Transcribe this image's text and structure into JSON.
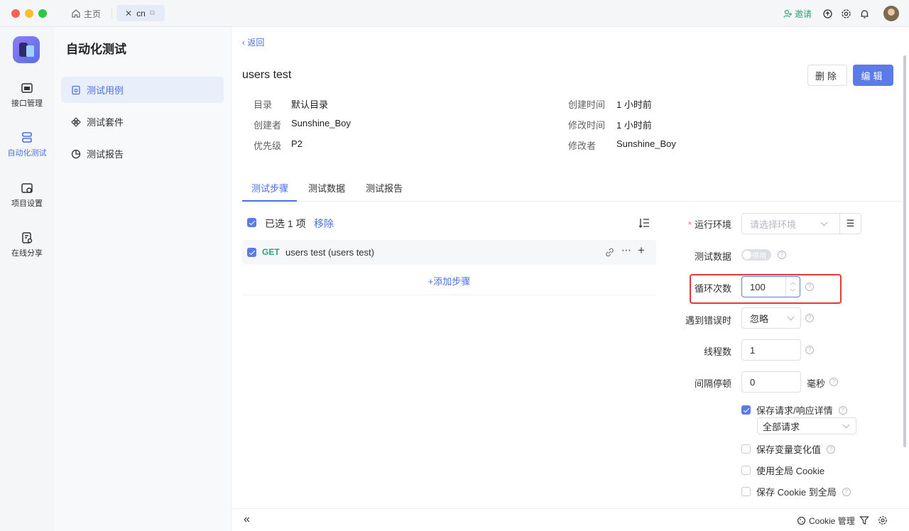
{
  "titlebar": {
    "home_tab": "主页",
    "active_tab": "cn",
    "invite": "邀请"
  },
  "rail": {
    "items": [
      {
        "label": "接口管理"
      },
      {
        "label": "自动化测试"
      },
      {
        "label": "项目设置"
      },
      {
        "label": "在线分享"
      }
    ]
  },
  "sidebar": {
    "title": "自动化测试",
    "items": [
      {
        "label": "测试用例"
      },
      {
        "label": "测试套件"
      },
      {
        "label": "测试报告"
      }
    ]
  },
  "header": {
    "back": "返回",
    "title": "users test",
    "delete_label": "删除",
    "edit_label": "编辑"
  },
  "meta": {
    "dir_k": "目录",
    "dir_v": "默认目录",
    "creator_k": "创建者",
    "creator_v": "Sunshine_Boy",
    "priority_k": "优先级",
    "priority_v": "P2",
    "created_k": "创建时间",
    "created_v": "1 小时前",
    "modified_k": "修改时间",
    "modified_v": "1 小时前",
    "modifier_k": "修改者",
    "modifier_v": "Sunshine_Boy"
  },
  "tabs": [
    "测试步骤",
    "测试数据",
    "测试报告"
  ],
  "steps": {
    "selected_text": "已选 1 项",
    "remove_label": "移除",
    "rows": [
      {
        "method": "GET",
        "name": "users test (users test)"
      }
    ],
    "add_step": "添加步骤"
  },
  "config": {
    "env_label": "运行环境",
    "env_placeholder": "请选择环境",
    "test_data_label": "测试数据",
    "test_data_toggle": "停用",
    "loop_label": "循环次数",
    "loop_value": "100",
    "on_error_label": "遇到错误时",
    "on_error_value": "忽略",
    "threads_label": "线程数",
    "threads_value": "1",
    "interval_label": "间隔停顿",
    "interval_value": "0",
    "interval_unit": "毫秒",
    "save_req_label": "保存请求/响应详情",
    "save_req_scope": "全部请求",
    "save_var_label": "保存变量变化值",
    "global_cookie_label": "使用全局 Cookie",
    "save_cookie_label": "保存 Cookie 到全局"
  },
  "footer": {
    "cookie_label": "Cookie 管理"
  },
  "colors": {
    "accent": "#4a6fe3",
    "primary_button": "#5b7be6",
    "get_method": "#2ba471",
    "highlight_border": "#e03a3a"
  }
}
